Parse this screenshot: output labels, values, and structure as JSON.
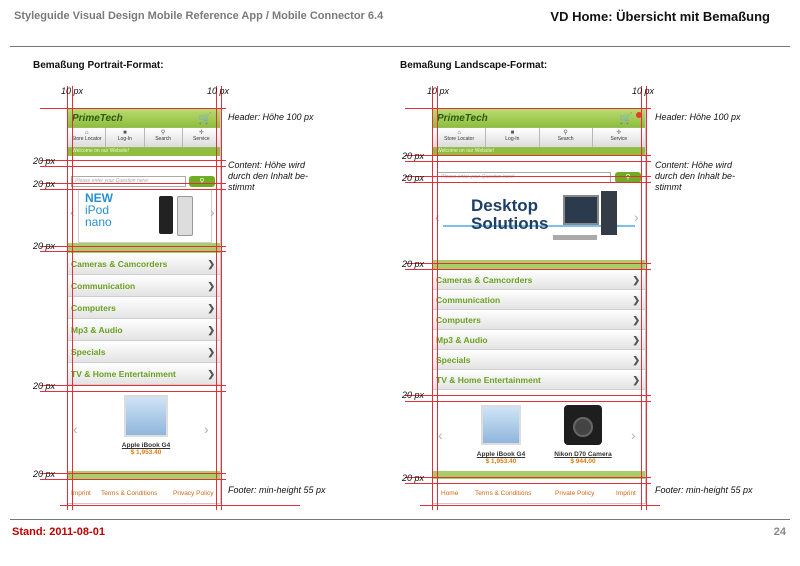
{
  "doc_title": "Styleguide Visual Design Mobile Reference App / Mobile Connector 6.4",
  "page_heading": "VD Home: Übersicht mit Bemaßung",
  "left_section_title": "Bemaßung Portrait-Format:",
  "right_section_title": "Bemaßung Landscape-Format:",
  "labels": {
    "px10": "10 px",
    "px20": "20 px"
  },
  "annotations": {
    "header": "Header: Höhe 100 px",
    "content": "Content: Höhe wird durch den Inhalt be-stimmt",
    "footer": "Footer: min-height 55 px"
  },
  "app": {
    "logo": "PrimeTech",
    "nav": [
      "Store Locator",
      "Log-In",
      "Search",
      "Service"
    ],
    "welcome": "Welcome on our Website!",
    "search_placeholder": "Please enter your Question here!",
    "categories": [
      "Cameras & Camcorders",
      "Communication",
      "Computers",
      "Mp3 & Audio",
      "Specials",
      "TV & Home Entertainment"
    ]
  },
  "portrait": {
    "banner": {
      "line1": "NEW",
      "line2": "iPod",
      "line3": "nano"
    },
    "product": {
      "name": "Apple iBook G4",
      "price": "$ 1,953.40"
    },
    "footer_links": [
      "Imprint",
      "Terms & Conditions",
      "Privacy Policy"
    ]
  },
  "landscape": {
    "banner": {
      "line1": "Desktop",
      "line2": "Solutions"
    },
    "products": [
      {
        "name": "Apple iBook G4",
        "price": "$ 1,953.40"
      },
      {
        "name": "Nikon D70 Camera",
        "price": "$ 944.00"
      }
    ],
    "footer_links": [
      "Home",
      "Terms & Conditions",
      "Private Policy",
      "Imprint"
    ]
  },
  "footer": {
    "date": "Stand: 2011-08-01",
    "page": "24"
  },
  "colors": {
    "accent_green": "#8fbe3e",
    "category_text": "#6aa121",
    "guide_red": "#e0303a",
    "date_red": "#c00000"
  }
}
